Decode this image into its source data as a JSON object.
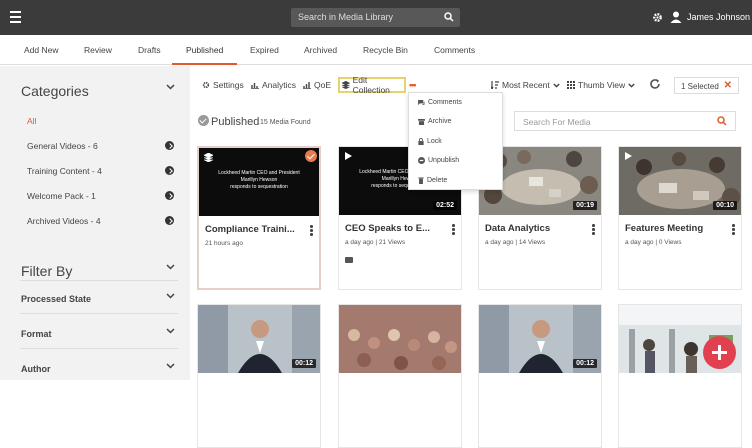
{
  "header": {
    "search_placeholder": "Search in Media Library",
    "user_name": "James Johnson"
  },
  "tabs": [
    "Add New",
    "Review",
    "Drafts",
    "Published",
    "Expired",
    "Archived",
    "Recycle Bin",
    "Comments"
  ],
  "sidebar": {
    "categories_title": "Categories",
    "categories": [
      "All",
      "General Videos - 6",
      "Training Content - 4",
      "Welcome Pack - 1",
      "Archived Videos - 4"
    ],
    "filter_title": "Filter By",
    "filters": [
      "Processed State",
      "Format",
      "Author"
    ]
  },
  "toolbar": {
    "settings": "Settings",
    "analytics": "Analytics",
    "qoe": "QoE",
    "edit_collection": "Edit Collection",
    "sort": "Most Recent",
    "view": "Thumb View",
    "selected": "1 Selected"
  },
  "published": {
    "title": "Published",
    "count": "15 Media Found",
    "search_placeholder": "Search For Media"
  },
  "menu": [
    "Comments",
    "Archive",
    "Lock",
    "Unpublish",
    "Delete"
  ],
  "cards": [
    {
      "title": "Compliance Traini...",
      "meta": "21 hours ago",
      "caption": "Lockheed Martin CEO and President\nMarillyn Hewson\nresponds to sequestration",
      "duration": ""
    },
    {
      "title": "CEO Speaks to E...",
      "meta": "a day ago  |  21 Views",
      "caption": "Lockheed Martin CEO and President\nMarillyn Hewson\nresponds to sequestration",
      "duration": "02:52"
    },
    {
      "title": "Data Analytics",
      "meta": "a day ago  |  14 Views",
      "caption": "",
      "duration": "00:19"
    },
    {
      "title": "Features Meeting",
      "meta": "a day ago  |  0 Views",
      "caption": "",
      "duration": "00:10"
    },
    {
      "duration": "00:12"
    },
    {
      "duration": ""
    },
    {
      "duration": "00:12"
    },
    {
      "duration": ""
    }
  ],
  "colors": {
    "accent": "#e05a2b",
    "topbar": "#3b3b3b",
    "fab": "#e0404f"
  }
}
